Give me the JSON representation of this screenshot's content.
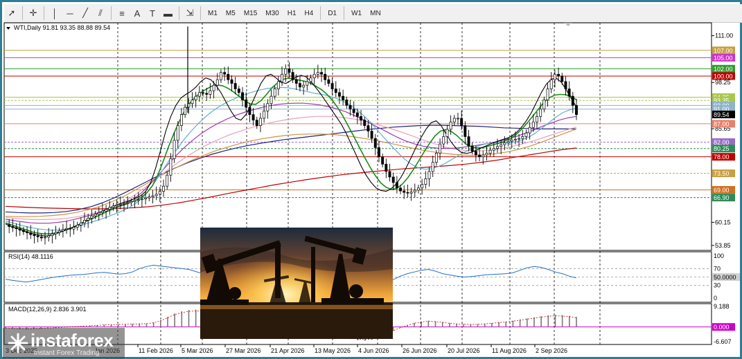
{
  "toolbar": {
    "tools": [
      {
        "name": "cursor-icon",
        "glyph": "➚"
      },
      {
        "name": "crosshair-icon",
        "glyph": "✛"
      },
      {
        "name": "vertical-line-icon",
        "glyph": "│"
      },
      {
        "name": "horizontal-line-icon",
        "glyph": "─"
      },
      {
        "name": "trendline-icon",
        "glyph": "╱"
      },
      {
        "name": "channel-icon",
        "glyph": "⫽"
      },
      {
        "name": "fibonacci-icon",
        "glyph": "≡"
      },
      {
        "name": "text-icon",
        "glyph": "A"
      },
      {
        "name": "label-icon",
        "glyph": "T"
      },
      {
        "name": "rectangle-icon",
        "glyph": "▬"
      },
      {
        "name": "arrows-icon",
        "glyph": "⇲"
      }
    ],
    "timeframes": [
      "M1",
      "M5",
      "M15",
      "M30",
      "H1",
      "H4",
      "D1",
      "W1",
      "MN"
    ]
  },
  "chart_data": {
    "type": "line",
    "symbol_header": "WTI,Daily  91.81 93.35 88.88 89.54",
    "price_axis": {
      "ylim": [
        52.5,
        114.5
      ],
      "ticks": [
        "111.00",
        "98.25",
        "85.65",
        "60.15",
        "53.85"
      ]
    },
    "time_axis": [
      "11 Feb 2026",
      "5 Mar 2026",
      "27 Mar 2026",
      "21 Apr 2026",
      "13 May 2026",
      "4 Jun 2026",
      "26 Jun 2026",
      "20 Jul 2026",
      "11 Aug 2026",
      "2 Sep 2026"
    ],
    "time_axis_cut": [
      "3 Dec 2025",
      "Jan 2026"
    ],
    "levels": [
      {
        "value": 107.0,
        "label": "107.00",
        "color": "#c8a040",
        "style": "solid"
      },
      {
        "value": 105.0,
        "label": "105.00",
        "color": "#cc33cc",
        "style": "solid"
      },
      {
        "value": 102.0,
        "label": "102.00",
        "color": "#2e9e2e",
        "style": "solid"
      },
      {
        "value": 100.0,
        "label": "100.00",
        "color": "#c00000",
        "style": "solid"
      },
      {
        "value": 94.25,
        "label": "94.25",
        "color": "#a8c84a",
        "style": "solid"
      },
      {
        "value": 93.35,
        "label": "93.35",
        "color": "#a8c84a",
        "style": "dashed"
      },
      {
        "value": 92.0,
        "label": "92.00",
        "color": "#8eb4c8",
        "style": "solid"
      },
      {
        "value": 91.0,
        "label": "91.00",
        "color": "#8eb4c8",
        "style": "solid"
      },
      {
        "value": 87.0,
        "label": "87.00",
        "color": "#e8806a",
        "style": "solid"
      },
      {
        "value": 82.0,
        "label": "82.00",
        "color": "#9a6ac8",
        "style": "dashed"
      },
      {
        "value": 80.25,
        "label": "80.25",
        "color": "#2e8b57",
        "style": "dashed"
      },
      {
        "value": 78.0,
        "label": "78.00",
        "color": "#c00000",
        "style": "solid"
      },
      {
        "value": 73.5,
        "label": "73.50",
        "color": "#c8a040",
        "style": "dashed"
      },
      {
        "value": 69.0,
        "label": "69.00",
        "color": "#d07020",
        "style": "solid"
      },
      {
        "value": 66.9,
        "label": "66.90",
        "color": "#2e8b57",
        "style": "dashed"
      }
    ],
    "current_price": {
      "value": 89.54,
      "label": "89.54",
      "color": "#000000"
    },
    "price_series": {
      "name": "WTI close",
      "values": [
        59.5,
        59.0,
        58.7,
        58.4,
        58.0,
        57.6,
        57.3,
        56.8,
        56.5,
        56.2,
        55.9,
        56.1,
        56.5,
        57.0,
        57.4,
        57.8,
        58.2,
        58.5,
        58.3,
        58.8,
        59.4,
        60.0,
        60.7,
        61.3,
        61.9,
        62.4,
        62.8,
        63.2,
        63.7,
        64.2,
        64.6,
        64.9,
        65.1,
        65.3,
        65.5,
        65.8,
        66.1,
        66.3,
        66.5,
        66.8,
        67.1,
        67.4,
        67.8,
        68.6,
        70.0,
        73.0,
        77.5,
        82.5,
        86.5,
        89.5,
        91.5,
        92.5,
        93.5,
        94.5,
        95.5,
        95.3,
        95.0,
        96.0,
        97.5,
        99.0,
        101.0,
        100.5,
        99.0,
        98.0,
        96.5,
        95.5,
        93.5,
        91.5,
        89.5,
        88.0,
        86.5,
        88.5,
        90.5,
        92.5,
        94.5,
        96.5,
        98.5,
        100.5,
        102.0,
        101.0,
        99.0,
        98.0,
        97.0,
        97.5,
        98.5,
        99.5,
        100.5,
        101.0,
        100.5,
        99.0,
        98.0,
        96.5,
        95.5,
        94.5,
        93.5,
        92.0,
        91.0,
        90.0,
        89.0,
        88.0,
        86.5,
        85.0,
        83.0,
        80.5,
        78.0,
        76.0,
        74.0,
        72.5,
        71.0,
        69.5,
        68.7,
        68.3,
        68.1,
        68.4,
        68.9,
        69.5,
        70.5,
        72.0,
        74.0,
        76.5,
        79.0,
        81.5,
        83.5,
        85.5,
        87.5,
        88.5,
        88.5,
        86.5,
        83.5,
        81.0,
        79.5,
        78.5,
        78.0,
        78.5,
        79.0,
        79.8,
        80.3,
        80.8,
        81.3,
        81.8,
        82.2,
        82.6,
        82.8,
        83.0,
        83.5,
        84.5,
        86.0,
        87.5,
        89.0,
        91.0,
        93.5,
        96.5,
        99.0,
        100.5,
        100.0,
        98.5,
        96.5,
        94.5,
        92.0,
        89.5
      ]
    },
    "ma_series": [
      {
        "name": "MA5",
        "color": "#000000",
        "values": [
          59.7,
          59.1,
          58.6,
          58.2,
          57.7,
          57.2,
          56.9,
          56.6,
          56.4,
          56.6,
          57.0,
          57.5,
          58.0,
          58.5,
          59.1,
          59.8,
          60.6,
          61.4,
          62.2,
          62.9,
          63.6,
          64.2,
          64.8,
          65.3,
          65.7,
          66.2,
          66.7,
          67.4,
          68.6,
          71.0,
          75.0,
          80.0,
          85.0,
          89.0,
          92.0,
          94.0,
          95.0,
          95.8,
          97.0,
          98.5,
          99.5,
          99.0,
          97.5,
          95.5,
          93.0,
          90.5,
          88.5,
          88.0,
          89.5,
          92.0,
          95.0,
          98.0,
          100.0,
          100.5,
          99.5,
          98.3,
          98.0,
          98.8,
          99.7,
          100.2,
          99.8,
          98.5,
          96.8,
          95.0,
          93.0,
          91.0,
          89.0,
          87.0,
          84.5,
          81.5,
          78.5,
          75.5,
          73.0,
          71.0,
          69.5,
          68.8,
          68.6,
          69.3,
          70.6,
          72.5,
          75.0,
          77.8,
          80.7,
          83.3,
          85.6,
          87.3,
          87.8,
          86.5,
          84.2,
          82.0,
          80.3,
          79.2,
          78.9,
          79.2,
          79.8,
          80.4,
          81.0,
          81.6,
          82.1,
          82.6,
          83.0,
          83.6,
          84.6,
          86.0,
          87.8,
          90.0,
          92.8,
          95.5,
          97.8,
          99.2,
          99.4,
          98.3,
          96.2,
          93.8,
          91.6
        ]
      },
      {
        "name": "MA10",
        "color": "#1a8a1a",
        "values": [
          60.0,
          59.5,
          59.0,
          58.5,
          58.0,
          57.5,
          57.2,
          57.0,
          57.0,
          57.2,
          57.6,
          58.1,
          58.6,
          59.2,
          59.8,
          60.5,
          61.2,
          61.9,
          62.6,
          63.3,
          63.9,
          64.5,
          65.0,
          65.6,
          66.2,
          67.0,
          68.2,
          70.1,
          73.0,
          76.8,
          80.8,
          84.5,
          87.8,
          90.7,
          92.8,
          94.4,
          95.6,
          96.5,
          97.3,
          97.6,
          97.3,
          96.6,
          95.6,
          94.4,
          93.3,
          92.4,
          92.3,
          93.3,
          95.0,
          96.8,
          98.1,
          99.1,
          99.4,
          99.2,
          98.9,
          98.6,
          98.1,
          97.3,
          96.4,
          95.2,
          93.6,
          91.6,
          89.2,
          86.5,
          83.7,
          80.8,
          78.0,
          75.3,
          72.9,
          70.9,
          69.7,
          69.1,
          69.4,
          70.6,
          72.3,
          74.5,
          76.9,
          79.4,
          81.7,
          83.7,
          85.0,
          85.4,
          84.9,
          83.8,
          82.4,
          81.1,
          80.5,
          80.4,
          80.6,
          81.0,
          81.4,
          81.8,
          82.4,
          83.1,
          84.2,
          85.6,
          87.3,
          89.1,
          91.0,
          92.8,
          94.1,
          94.8,
          95.0,
          94.9,
          94.5,
          93.5
        ]
      },
      {
        "name": "MA20",
        "color": "#5fb0d0",
        "values": [
          60.5,
          60.0,
          59.5,
          59.0,
          58.6,
          58.3,
          58.1,
          58.0,
          58.1,
          58.4,
          58.8,
          59.3,
          59.9,
          60.5,
          61.1,
          61.8,
          62.5,
          63.3,
          64.2,
          65.4,
          67.0,
          69.2,
          71.9,
          74.8,
          77.6,
          80.3,
          82.8,
          85.0,
          87.0,
          88.8,
          90.3,
          91.6,
          92.7,
          93.6,
          94.4,
          95.1,
          95.7,
          96.2,
          96.6,
          96.8,
          96.9,
          96.8,
          96.5,
          96.1,
          95.7,
          95.3,
          95.0,
          94.6,
          94.0,
          93.2,
          92.2,
          90.9,
          89.3,
          87.5,
          85.4,
          83.3,
          81.2,
          79.2,
          77.4,
          76.0,
          75.0,
          74.6,
          74.8,
          75.4,
          76.3,
          77.4,
          78.5,
          79.5,
          80.4,
          81.1,
          81.6,
          81.8,
          81.8,
          81.8,
          82.0,
          82.5,
          83.3,
          84.4,
          85.8,
          87.3,
          88.8,
          90.0,
          90.8,
          91.2
        ]
      },
      {
        "name": "MA34",
        "color": "#9a3ab0",
        "values": [
          61.0,
          60.6,
          60.3,
          60.0,
          59.9,
          59.9,
          60.1,
          60.4,
          60.9,
          61.5,
          62.1,
          62.8,
          63.5,
          64.3,
          65.2,
          66.5,
          68.3,
          70.6,
          73.2,
          75.8,
          78.3,
          80.6,
          82.6,
          84.4,
          85.9,
          87.2,
          88.3,
          89.3,
          90.1,
          90.8,
          91.4,
          91.9,
          92.3,
          92.5,
          92.6,
          92.6,
          92.4,
          92.1,
          91.6,
          91.0,
          90.2,
          89.2,
          88.1,
          86.9,
          85.7,
          84.5,
          83.3,
          82.3,
          81.5,
          80.9,
          80.5,
          80.3,
          80.3,
          80.4,
          80.7,
          81.0,
          81.4,
          81.8,
          82.3,
          82.9,
          83.6,
          84.4,
          85.3,
          86.3,
          87.2,
          88.0,
          88.6,
          89.0
        ]
      },
      {
        "name": "MA50",
        "color": "#e8a0b8",
        "values": [
          61.5,
          61.2,
          61.0,
          60.9,
          60.9,
          61.0,
          61.2,
          61.6,
          62.1,
          62.8,
          63.6,
          64.6,
          66.0,
          67.8,
          69.8,
          71.9,
          74.0,
          76.0,
          77.9,
          79.6,
          81.1,
          82.4,
          83.6,
          84.6,
          85.5,
          86.3,
          87.0,
          87.6,
          88.1,
          88.5,
          88.8,
          89.0,
          89.0,
          88.9,
          88.6,
          88.2,
          87.6,
          86.9,
          86.1,
          85.2,
          84.3,
          83.3,
          82.3,
          81.4,
          80.6,
          80.0,
          79.7,
          79.6,
          79.7,
          80.0,
          80.5,
          81.1,
          81.8,
          82.6,
          83.5,
          84.4,
          85.3,
          86.1
        ]
      },
      {
        "name": "MA89",
        "color": "#d09040",
        "values": [
          61.8,
          61.7,
          61.7,
          61.8,
          62.0,
          62.3,
          62.8,
          63.5,
          64.4,
          65.6,
          67.0,
          68.7,
          70.5,
          72.3,
          74.0,
          75.6,
          77.1,
          78.4,
          79.6,
          80.6,
          81.5,
          82.3,
          82.9,
          83.4,
          83.8,
          84.1,
          84.2,
          84.2,
          84.1,
          83.8,
          83.4,
          82.9,
          82.3,
          81.7,
          81.0,
          80.3,
          79.7,
          79.2,
          78.8,
          78.5,
          78.4,
          78.5,
          78.8,
          79.3,
          80.0,
          80.9,
          82.0,
          83.2,
          84.4,
          85.6
        ]
      },
      {
        "name": "MA144",
        "color": "#1a237e",
        "values": [
          63.0,
          62.8,
          62.7,
          62.7,
          62.8,
          63.1,
          63.6,
          64.4,
          65.5,
          66.9,
          68.5,
          70.2,
          71.9,
          73.5,
          75.0,
          76.4,
          77.6,
          78.7,
          79.6,
          80.4,
          81.1,
          81.7,
          82.2,
          82.7,
          83.1,
          83.5,
          83.9,
          84.3,
          84.7,
          85.1,
          85.5,
          85.8,
          86.1,
          86.3,
          86.5,
          86.6,
          86.6,
          86.5,
          86.4,
          86.3,
          86.1,
          85.9,
          85.8,
          85.7,
          85.6,
          85.6,
          85.6,
          85.6
        ]
      },
      {
        "name": "MA233",
        "color": "#c00000",
        "values": [
          64.5,
          64.3,
          64.1,
          64.0,
          63.9,
          63.8,
          63.8,
          63.9,
          64.1,
          64.4,
          64.9,
          65.5,
          66.3,
          67.1,
          68.0,
          68.8,
          69.6,
          70.4,
          71.1,
          71.8,
          72.4,
          73.0,
          73.5,
          73.9,
          74.3,
          74.7,
          75.0,
          75.3,
          75.6,
          76.0,
          76.5,
          77.1,
          77.8,
          78.5,
          79.2,
          79.9,
          80.4
        ]
      }
    ],
    "rsi": {
      "label": "RSI(14) 48.1116",
      "ticks": [
        "100",
        "70",
        "50",
        "30",
        "0"
      ],
      "last": "50.0000",
      "values": [
        45,
        42,
        40,
        38,
        41,
        44,
        47,
        50,
        52,
        54,
        55,
        56,
        58,
        60,
        61,
        59,
        57,
        58,
        62,
        70,
        75,
        78,
        76,
        74,
        72,
        70,
        68,
        63,
        58,
        55,
        62,
        68,
        72,
        70,
        66,
        60,
        55,
        52,
        56,
        62,
        66,
        63,
        58,
        54,
        50,
        46,
        42,
        38,
        35,
        33,
        31,
        30,
        32,
        35,
        38,
        44,
        52,
        58,
        62,
        66,
        68,
        64,
        58,
        55,
        52,
        50,
        51,
        53,
        55,
        56,
        57,
        58,
        60,
        66,
        72,
        75,
        73,
        68,
        62,
        58,
        52,
        48
      ]
    },
    "macd": {
      "label": "MACD(12,26,9) 2.836 3.901",
      "ticks": [
        "9.188",
        "0.000",
        "-6.607"
      ],
      "last": "0.000",
      "hist": [
        -0.6,
        -0.8,
        -1.0,
        -1.1,
        -1.0,
        -0.8,
        -0.6,
        -0.4,
        -0.2,
        0.0,
        0.2,
        0.4,
        0.6,
        0.8,
        1.0,
        1.1,
        1.2,
        1.3,
        1.4,
        1.5,
        1.6,
        2.0,
        3.0,
        4.5,
        6.0,
        7.0,
        7.6,
        7.8,
        7.5,
        7.0,
        6.4,
        6.0,
        6.2,
        6.6,
        7.0,
        6.8,
        6.2,
        5.4,
        4.6,
        4.0,
        3.6,
        3.2,
        2.6,
        1.8,
        0.8,
        -0.4,
        -1.8,
        -3.2,
        -4.4,
        -5.4,
        -6.0,
        -6.2,
        -5.8,
        -4.8,
        -3.4,
        -1.8,
        -0.4,
        0.8,
        1.8,
        2.4,
        2.8,
        2.6,
        2.2,
        1.8,
        1.5,
        1.3,
        1.2,
        1.3,
        1.5,
        1.8,
        2.1,
        2.4,
        2.8,
        3.3,
        3.8,
        4.3,
        4.8,
        5.2,
        5.4,
        5.3,
        5.0,
        4.5
      ]
    },
    "image_caption": "",
    "brand": {
      "name": "instaforex",
      "tagline": "Instant Forex Trading"
    }
  }
}
